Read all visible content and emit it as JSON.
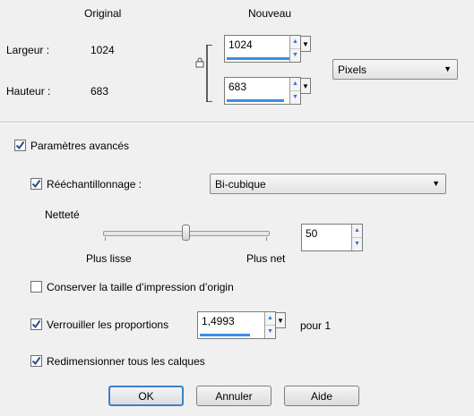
{
  "header": {
    "original": "Original",
    "nouveau": "Nouveau"
  },
  "width_row": {
    "label": "Largeur :",
    "original": "1024",
    "value": "1024"
  },
  "height_row": {
    "label": "Hauteur :",
    "original": "683",
    "value": "683"
  },
  "unit_select": {
    "value": "Pixels"
  },
  "advanced": {
    "label": "Paramètres avancés",
    "checked": true
  },
  "resample": {
    "label": "Rééchantillonnage :",
    "checked": true,
    "method": "Bi-cubique"
  },
  "sharpness": {
    "label": "Netteté",
    "value": "50",
    "slider_fraction": 0.5,
    "min_label": "Plus lisse",
    "max_label": "Plus net"
  },
  "keep_print_size": {
    "label": "Conserver la taille d’impression d’origin",
    "checked": false
  },
  "lock_ratio": {
    "label": "Verrouiller les proportions",
    "checked": true,
    "value": "1,4993",
    "suffix": "pour 1"
  },
  "resize_layers": {
    "label": "Redimensionner tous les calques",
    "checked": true
  },
  "buttons": {
    "ok": "OK",
    "cancel": "Annuler",
    "help": "Aide"
  },
  "colors": {
    "accent": "#3a8ee6",
    "check": "#2a4f8f"
  },
  "icons": {
    "lock": "lock-icon",
    "check": "check-icon"
  }
}
